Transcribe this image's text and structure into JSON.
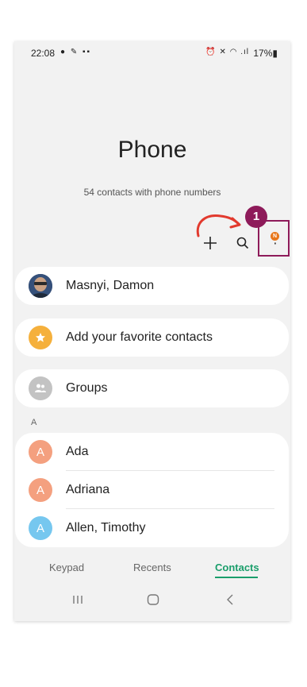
{
  "status_bar": {
    "time": "22:08",
    "left_icons": "● ✎ ▪▪",
    "right_icons": "⏰ ✕ ◠ .ıl",
    "battery": "17%▮"
  },
  "header": {
    "title": "Phone",
    "subtitle": "54 contacts with phone numbers"
  },
  "toolbar": {
    "add_icon": "plus-icon",
    "search_icon": "search-icon",
    "more_icon": "more-options-icon",
    "notification_badge": "N"
  },
  "annotation": {
    "step_number": "1",
    "highlight_color": "#8e1b5a"
  },
  "profile": {
    "name": "Masnyi, Damon"
  },
  "favorites": {
    "label": "Add your favorite contacts",
    "icon": "star-icon",
    "color": "#f5b03c"
  },
  "groups": {
    "label": "Groups",
    "icon": "people-icon",
    "color": "#c3c3c3"
  },
  "contacts_section": {
    "letter": "A",
    "items": [
      {
        "initial": "A",
        "name": "Ada",
        "color": "#f4a07f"
      },
      {
        "initial": "A",
        "name": "Adriana",
        "color": "#f4a07f"
      },
      {
        "initial": "A",
        "name": "Allen, Timothy",
        "color": "#76c7ef"
      }
    ]
  },
  "tabs": [
    {
      "label": "Keypad",
      "active": false
    },
    {
      "label": "Recents",
      "active": false
    },
    {
      "label": "Contacts",
      "active": true
    }
  ],
  "accent_color": "#1a9e6b",
  "navbar": {
    "recents": "|||",
    "home": "○",
    "back": "<"
  }
}
